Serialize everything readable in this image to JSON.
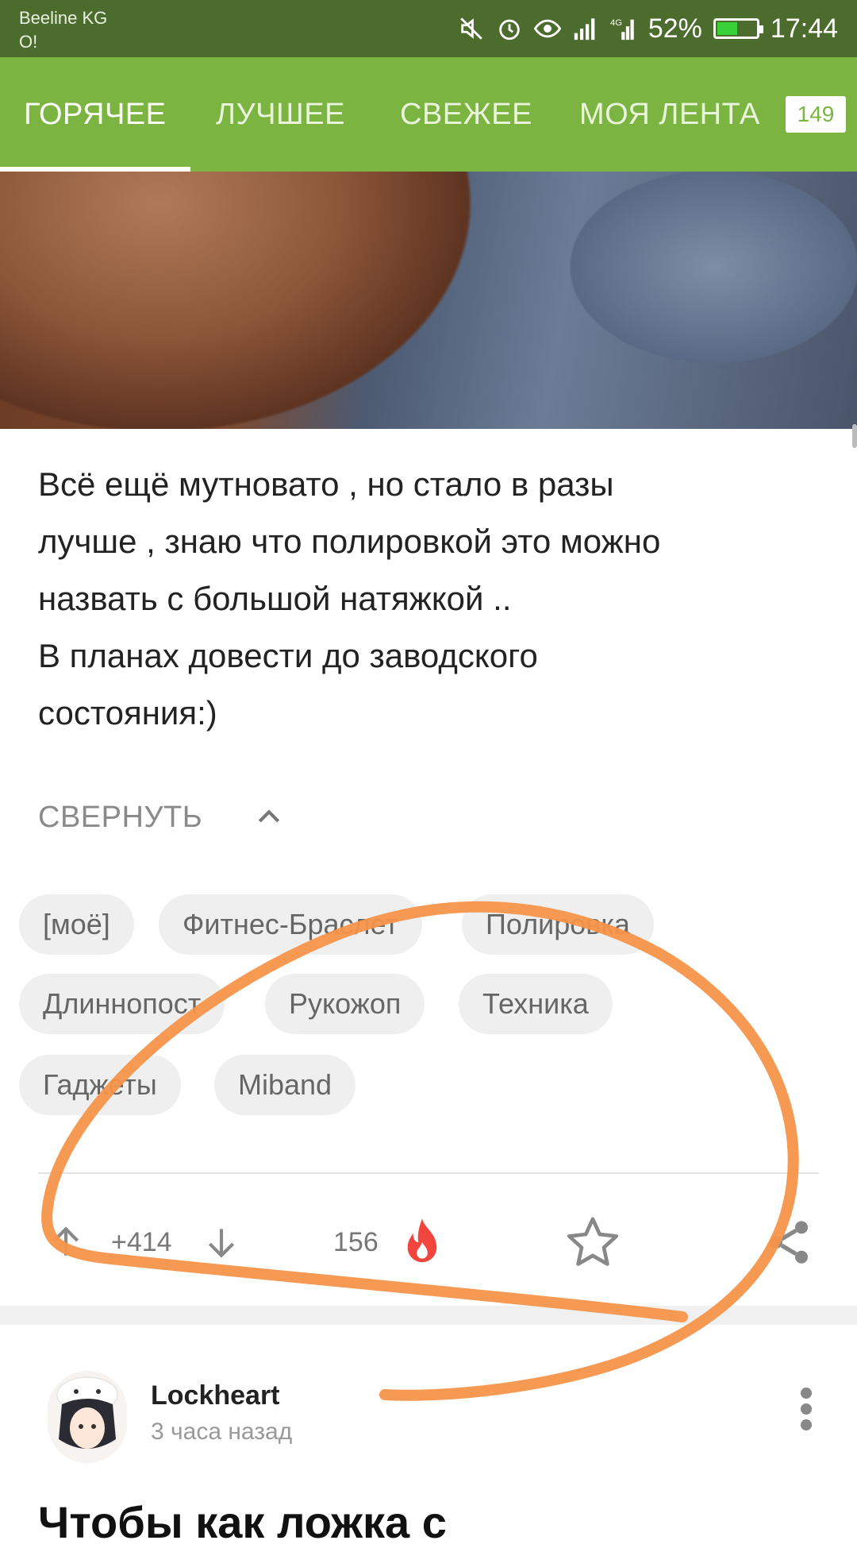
{
  "status_bar": {
    "carrier_line1": "Beeline KG",
    "carrier_line2": "O!",
    "battery_percent": "52%",
    "battery_level": 0.52,
    "time": "17:44",
    "icons": [
      "mute-icon",
      "alarm-icon",
      "eye-icon",
      "signal-icon",
      "4g-signal-icon",
      "battery-icon"
    ]
  },
  "tabs": {
    "items": [
      {
        "label": "ГОРЯЧЕЕ",
        "active": true
      },
      {
        "label": "ЛУЧШЕЕ",
        "active": false
      },
      {
        "label": "СВЕЖЕЕ",
        "active": false
      },
      {
        "label": "МОЯ ЛЕНТА",
        "active": false
      }
    ],
    "badge": "149"
  },
  "post": {
    "text_lines": [
      "Всё ещё мутновато , но стало в разы",
      "лучше , знаю что полировкой это можно",
      "назвать с большой натяжкой ..",
      "В планах довести до заводского",
      "состояния:)"
    ],
    "collapse_label": "СВЕРНУТЬ",
    "tags": [
      "[моё]",
      "Фитнес-Браслет",
      "Полировка",
      "Длиннопост",
      "Рукожоп",
      "Техника",
      "Гаджеты",
      "Miband"
    ],
    "rating": "+414",
    "comments": "156"
  },
  "next_post": {
    "author": "Lockheart",
    "time": "3 часа назад",
    "title_partial": "Чтобы как ложка с"
  },
  "colors": {
    "status_bar": "#4b6c2c",
    "tab_bar": "#7bb441",
    "tag_bg": "#efefef",
    "fire": "#f2453d",
    "scribble": "#f5944a"
  }
}
